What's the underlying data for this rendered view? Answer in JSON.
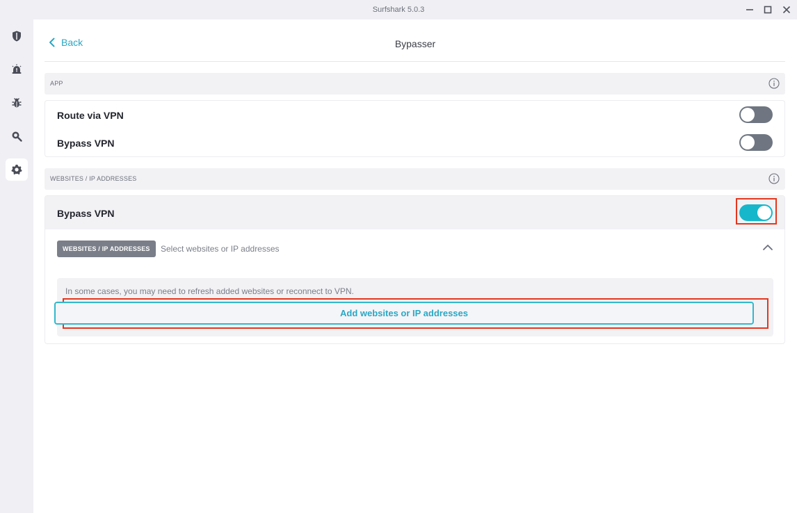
{
  "window": {
    "title": "Surfshark 5.0.3",
    "controls": {
      "minimize": "minimize-icon",
      "maximize": "maximize-icon",
      "close": "close-icon"
    }
  },
  "sidebar": {
    "items": [
      {
        "icon": "shield-icon",
        "active": false
      },
      {
        "icon": "alert-icon",
        "active": false
      },
      {
        "icon": "bug-icon",
        "active": false
      },
      {
        "icon": "search-icon",
        "active": false
      },
      {
        "icon": "gear-icon",
        "active": true
      }
    ]
  },
  "header": {
    "back_label": "Back",
    "title": "Bypasser"
  },
  "app_section": {
    "label": "APP",
    "rows": [
      {
        "label": "Route via VPN",
        "enabled": false
      },
      {
        "label": "Bypass VPN",
        "enabled": false
      }
    ]
  },
  "websites_section": {
    "label": "WEBSITES / IP ADDRESSES",
    "bypass_row": {
      "label": "Bypass VPN",
      "enabled": true
    },
    "chip_label": "WEBSITES / IP ADDRESSES",
    "chip_description": "Select websites or IP addresses",
    "notice": "In some cases, you may need to refresh added websites or reconnect to VPN.",
    "add_button_label": "Add websites or IP addresses"
  },
  "colors": {
    "accent": "#2aa7c4",
    "toggle_on": "#16b7ca",
    "toggle_off": "#6f7681",
    "highlight": "#e4361c"
  }
}
